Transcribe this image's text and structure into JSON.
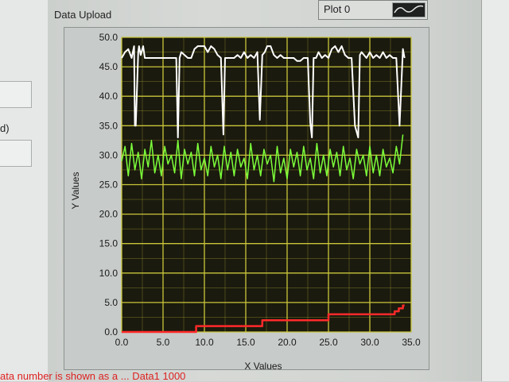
{
  "window": {
    "graph_title": "Data Upload",
    "left_partial_label": "d)",
    "bottom_partial_text": "ata number is shown as a ... Data1 1000"
  },
  "legend": {
    "name": "Plot 0",
    "swatch_icon": "sine-wave-icon"
  },
  "colors": {
    "plot_bg": "#1b1a0e",
    "grid": "#c9c63a",
    "series_white": "#ffffff",
    "series_green": "#7cff3a",
    "series_red": "#ff2a2a"
  },
  "chart_data": {
    "type": "line",
    "xlabel": "X Values",
    "ylabel": "Y Values",
    "xlim": [
      0,
      35
    ],
    "ylim": [
      0,
      50
    ],
    "xticks": [
      "0.0",
      "5.0",
      "10.0",
      "15.0",
      "20.0",
      "25.0",
      "30.0",
      "35.0"
    ],
    "yticks": [
      "0.0",
      "5.0",
      "10.0",
      "15.0",
      "20.0",
      "25.0",
      "30.0",
      "35.0",
      "40.0",
      "45.0",
      "50.0"
    ],
    "grid": true,
    "series": [
      {
        "color": "white",
        "x": [
          0,
          0.4,
          0.8,
          1.2,
          1.5,
          1.6,
          1.7,
          2.0,
          2.1,
          2.3,
          2.6,
          2.8,
          3.1,
          3.3,
          3.6,
          4.0,
          5.0,
          6.0,
          6.6,
          6.8,
          7.0,
          7.2,
          7.6,
          8.0,
          8.4,
          8.8,
          9.2,
          9.6,
          10.0,
          10.4,
          10.8,
          11.2,
          11.6,
          12.0,
          12.3,
          12.5,
          12.8,
          13.2,
          13.6,
          14.0,
          14.4,
          14.8,
          15.2,
          15.6,
          16.0,
          16.4,
          16.7,
          17.0,
          17.3,
          17.6,
          18.0,
          18.4,
          18.8,
          19.2,
          19.6,
          20.0,
          20.4,
          20.8,
          21.2,
          21.6,
          22.0,
          22.5,
          22.8,
          23.0,
          23.2,
          23.5,
          23.8,
          24.2,
          24.6,
          25.0,
          25.4,
          25.8,
          26.2,
          26.6,
          27.0,
          27.4,
          27.8,
          28.2,
          28.6,
          28.8,
          29.0,
          29.3,
          29.6,
          30.0,
          30.4,
          30.8,
          31.2,
          31.6,
          32.0,
          32.4,
          32.8,
          33.2,
          33.6,
          34.0,
          34.2
        ],
        "y": [
          46.5,
          47.5,
          48.0,
          46.5,
          48.5,
          35.0,
          35.0,
          47.5,
          48.5,
          47.0,
          48.5,
          46.5,
          46.5,
          46.5,
          46.5,
          46.5,
          46.5,
          46.5,
          46.5,
          33.0,
          46.5,
          47.5,
          47.0,
          46.5,
          46.5,
          48.0,
          48.5,
          48.5,
          48.5,
          47.5,
          48.5,
          48.0,
          47.0,
          46.5,
          33.5,
          46.5,
          46.5,
          46.5,
          46.5,
          47.0,
          46.5,
          47.5,
          46.5,
          47.0,
          46.5,
          47.5,
          36.0,
          47.0,
          47.5,
          48.5,
          48.5,
          47.0,
          46.5,
          47.0,
          46.5,
          46.5,
          46.5,
          46.5,
          46.0,
          46.0,
          46.5,
          46.5,
          35.5,
          33.0,
          46.5,
          46.5,
          47.5,
          46.5,
          47.0,
          46.5,
          48.0,
          48.5,
          47.5,
          48.5,
          47.0,
          46.5,
          46.5,
          35.0,
          33.0,
          47.0,
          47.5,
          47.0,
          46.5,
          47.5,
          46.5,
          47.0,
          46.5,
          47.5,
          46.5,
          47.0,
          46.5,
          46.5,
          35.0,
          48.0,
          46.5
        ]
      },
      {
        "color": "green",
        "x": [
          0,
          0.4,
          0.8,
          1.2,
          1.6,
          2.0,
          2.4,
          2.8,
          3.2,
          3.6,
          4.0,
          4.4,
          4.8,
          5.2,
          5.6,
          6.0,
          6.4,
          6.8,
          7.2,
          7.6,
          8.0,
          8.4,
          8.8,
          9.2,
          9.6,
          10.0,
          10.4,
          10.8,
          11.2,
          11.6,
          12.0,
          12.4,
          12.8,
          13.2,
          13.6,
          14.0,
          14.4,
          14.8,
          15.2,
          15.6,
          16.0,
          16.4,
          16.8,
          17.2,
          17.6,
          18.0,
          18.4,
          18.8,
          19.2,
          19.6,
          20.0,
          20.4,
          20.8,
          21.2,
          21.6,
          22.0,
          22.4,
          22.8,
          23.2,
          23.6,
          24.0,
          24.4,
          24.8,
          25.2,
          25.6,
          26.0,
          26.4,
          26.8,
          27.2,
          27.6,
          28.0,
          28.4,
          28.8,
          29.2,
          29.6,
          30.0,
          30.4,
          30.8,
          31.2,
          31.6,
          32.0,
          32.4,
          32.8,
          33.2,
          33.6,
          34.0
        ],
        "y": [
          29.0,
          31.5,
          26.5,
          32.0,
          27.5,
          30.5,
          26.0,
          31.0,
          28.0,
          32.5,
          27.0,
          30.0,
          26.5,
          31.5,
          28.5,
          30.0,
          27.0,
          32.5,
          26.0,
          31.0,
          28.5,
          30.5,
          26.5,
          32.0,
          27.5,
          29.5,
          26.5,
          31.5,
          28.0,
          30.0,
          26.0,
          31.5,
          27.5,
          30.5,
          26.5,
          31.0,
          28.0,
          29.5,
          26.0,
          32.0,
          27.5,
          30.0,
          26.5,
          31.0,
          28.5,
          30.0,
          25.5,
          31.5,
          27.0,
          29.5,
          26.0,
          31.0,
          28.0,
          30.5,
          26.5,
          31.5,
          27.5,
          29.5,
          26.0,
          32.0,
          27.0,
          30.0,
          26.5,
          31.0,
          28.0,
          30.5,
          26.5,
          31.5,
          27.5,
          29.5,
          26.0,
          31.0,
          28.5,
          30.0,
          26.5,
          31.5,
          27.0,
          30.0,
          26.5,
          31.0,
          28.0,
          29.5,
          27.0,
          31.5,
          28.5,
          33.5
        ]
      },
      {
        "color": "red",
        "x": [
          0,
          9.0,
          9.0,
          17.0,
          17.0,
          25.0,
          25.0,
          33.0,
          33.0,
          33.5,
          33.5,
          34.0,
          34.0,
          34.2
        ],
        "y": [
          0,
          0,
          1.0,
          1.0,
          2.0,
          2.0,
          3.0,
          3.0,
          3.5,
          3.5,
          4.0,
          4.0,
          4.5,
          4.5
        ]
      }
    ]
  }
}
